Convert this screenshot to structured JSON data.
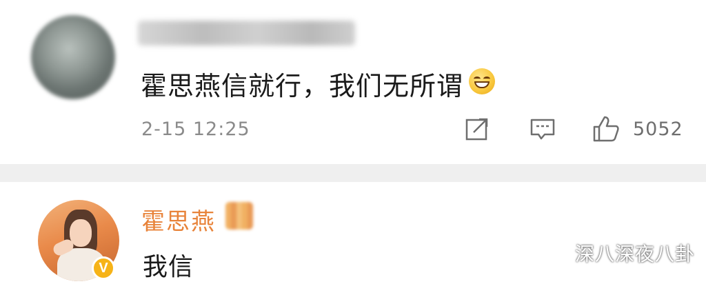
{
  "comment1": {
    "text": "霍思燕信就行，我们无所谓",
    "emoji": "grinning-smile",
    "time": "2-15 12:25",
    "like_count": "5052"
  },
  "comment2": {
    "username": "霍思燕",
    "verified_badge": "V",
    "text": "我信"
  },
  "watermark": {
    "text": "深八深夜八卦"
  },
  "colors": {
    "username_orange": "#e8833a",
    "badge_gold": "#f6b318",
    "divider": "#efefef",
    "meta_gray": "#8a8a8a"
  }
}
